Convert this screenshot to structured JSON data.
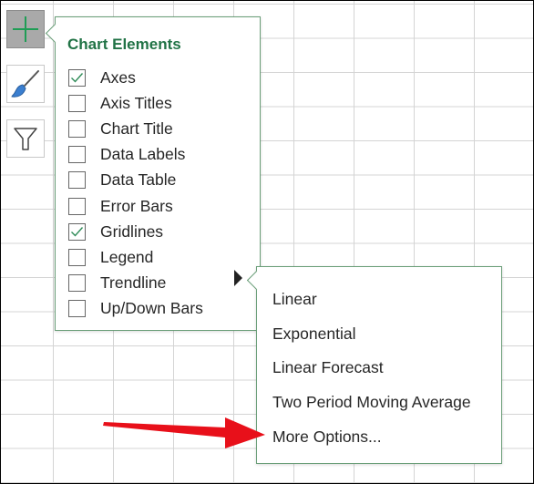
{
  "side_buttons": [
    {
      "icon": "plus-icon",
      "active": true
    },
    {
      "icon": "paintbrush-icon",
      "active": false
    },
    {
      "icon": "funnel-icon",
      "active": false
    }
  ],
  "chart_elements": {
    "title": "Chart Elements",
    "items": [
      {
        "label": "Axes",
        "checked": true
      },
      {
        "label": "Axis Titles",
        "checked": false
      },
      {
        "label": "Chart Title",
        "checked": false
      },
      {
        "label": "Data Labels",
        "checked": false
      },
      {
        "label": "Data Table",
        "checked": false
      },
      {
        "label": "Error Bars",
        "checked": false
      },
      {
        "label": "Gridlines",
        "checked": true
      },
      {
        "label": "Legend",
        "checked": false
      },
      {
        "label": "Trendline",
        "checked": false
      },
      {
        "label": "Up/Down Bars",
        "checked": false
      }
    ]
  },
  "trendline_submenu": {
    "items": [
      {
        "label": "Linear"
      },
      {
        "label": "Exponential"
      },
      {
        "label": "Linear Forecast"
      },
      {
        "label": "Two Period Moving Average"
      },
      {
        "label": "More Options..."
      }
    ]
  },
  "colors": {
    "accent": "#217346",
    "check": "#2e8b57",
    "arrow": "#e8101a"
  }
}
